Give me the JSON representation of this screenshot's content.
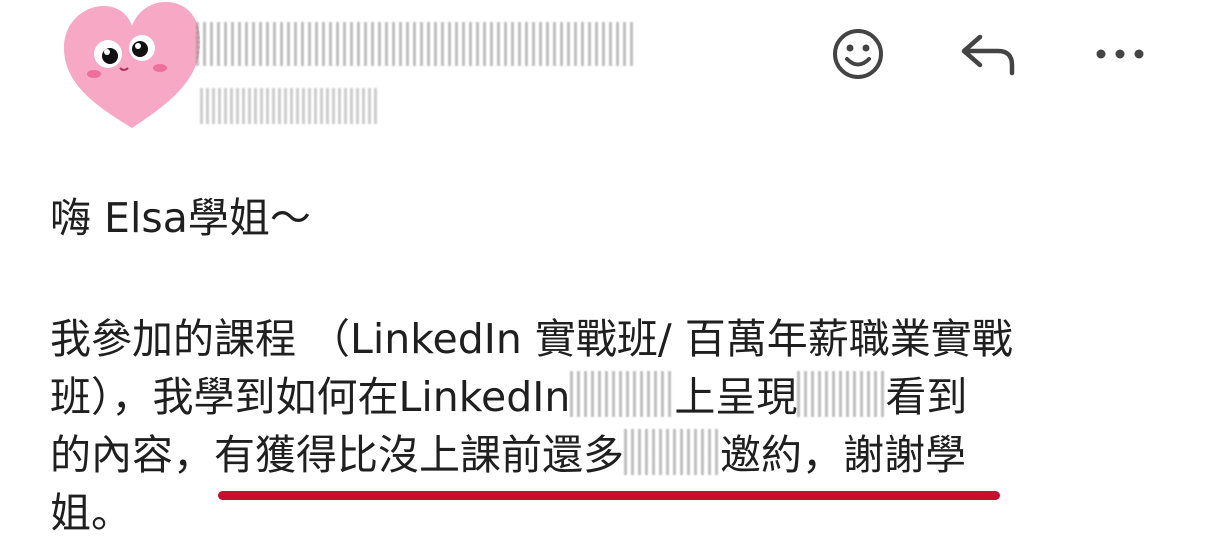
{
  "header": {
    "icons": {
      "emoji": "smiley-face-icon",
      "reply": "reply-arrow-icon",
      "more": "more-horizontal-icon"
    }
  },
  "message": {
    "greeting": "嗨 Elsa學姐～",
    "line1": "我參加的課程 （LinkedIn 實戰班/ 百萬年薪職業實戰",
    "line2_a": "班），我學到如何在LinkedIn",
    "line2_b": "上呈現",
    "line2_c": "看到",
    "line3_a": "的內容，",
    "line3_b": "有獲得比沒上課前還多",
    "line3_c": "邀約",
    "line3_d": "，謝謝學",
    "line4": "姐。"
  },
  "colors": {
    "underline": "#c8102e",
    "text": "#1f1f1f",
    "avatar_heart": "#f7a8c4"
  }
}
